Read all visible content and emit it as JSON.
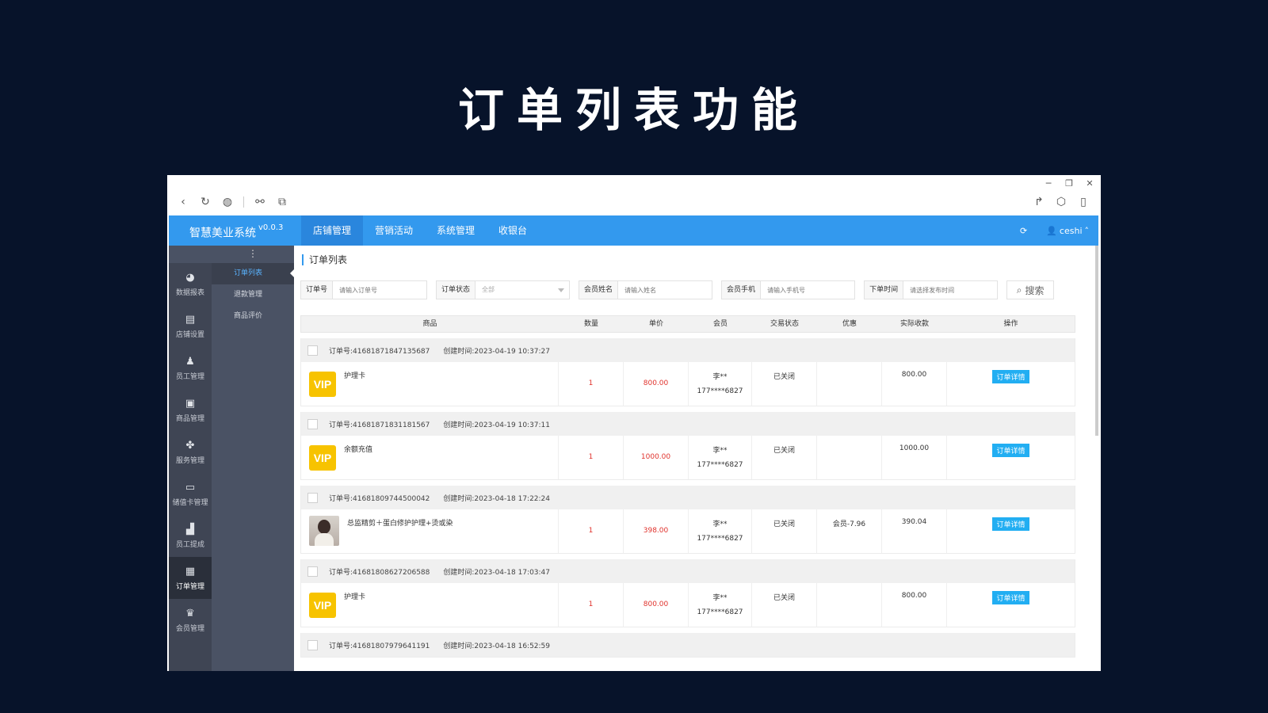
{
  "slide": {
    "title": "订单列表功能"
  },
  "header": {
    "brand": "智慧美业系统",
    "version": "v0.0.3",
    "nav": [
      "店铺管理",
      "营销活动",
      "系统管理",
      "收银台"
    ],
    "user": "ceshi"
  },
  "sidebar": {
    "items": [
      "数据报表",
      "店铺设置",
      "员工管理",
      "商品管理",
      "服务管理",
      "储值卡管理",
      "员工提成",
      "订单管理",
      "会员管理"
    ]
  },
  "subnav": {
    "items": [
      "订单列表",
      "退款管理",
      "商品评价"
    ]
  },
  "page": {
    "title": "订单列表"
  },
  "filters": {
    "order_no": {
      "label": "订单号",
      "placeholder": "请输入订单号"
    },
    "status": {
      "label": "订单状态",
      "value": "全部"
    },
    "member_name": {
      "label": "会员姓名",
      "placeholder": "请输入姓名"
    },
    "member_phone": {
      "label": "会员手机",
      "placeholder": "请输入手机号"
    },
    "order_time": {
      "label": "下单时间",
      "placeholder": "请选择发布时间"
    },
    "search": "搜索"
  },
  "table": {
    "columns": [
      "商品",
      "数量",
      "单价",
      "会员",
      "交易状态",
      "优惠",
      "实际收款",
      "操作"
    ],
    "orders": [
      {
        "no": "订单号:41681871847135687",
        "created": "创建时间:2023-04-19 10:37:27",
        "goods": "护理卡",
        "thumb": "vip",
        "qty": "1",
        "price": "800.00",
        "member": "李**",
        "phone": "177****6827",
        "status": "已关闭",
        "discount": "",
        "paid": "800.00",
        "action": "订单详情"
      },
      {
        "no": "订单号:41681871831181567",
        "created": "创建时间:2023-04-19 10:37:11",
        "goods": "余额充值",
        "thumb": "vip",
        "qty": "1",
        "price": "1000.00",
        "member": "李**",
        "phone": "177****6827",
        "status": "已关闭",
        "discount": "",
        "paid": "1000.00",
        "action": "订单详情"
      },
      {
        "no": "订单号:41681809744500042",
        "created": "创建时间:2023-04-18 17:22:24",
        "goods": "总监精剪＋蛋白修护护理+烫或染",
        "thumb": "photo",
        "qty": "1",
        "price": "398.00",
        "member": "李**",
        "phone": "177****6827",
        "status": "已关闭",
        "discount": "会员-7.96",
        "paid": "390.04",
        "action": "订单详情"
      },
      {
        "no": "订单号:41681808627206588",
        "created": "创建时间:2023-04-18 17:03:47",
        "goods": "护理卡",
        "thumb": "vip",
        "qty": "1",
        "price": "800.00",
        "member": "李**",
        "phone": "177****6827",
        "status": "已关闭",
        "discount": "",
        "paid": "800.00",
        "action": "订单详情"
      },
      {
        "no": "订单号:41681807979641191",
        "created": "创建时间:2023-04-18 16:52:59"
      }
    ]
  },
  "icons": {
    "vip_badge": "VIP"
  }
}
